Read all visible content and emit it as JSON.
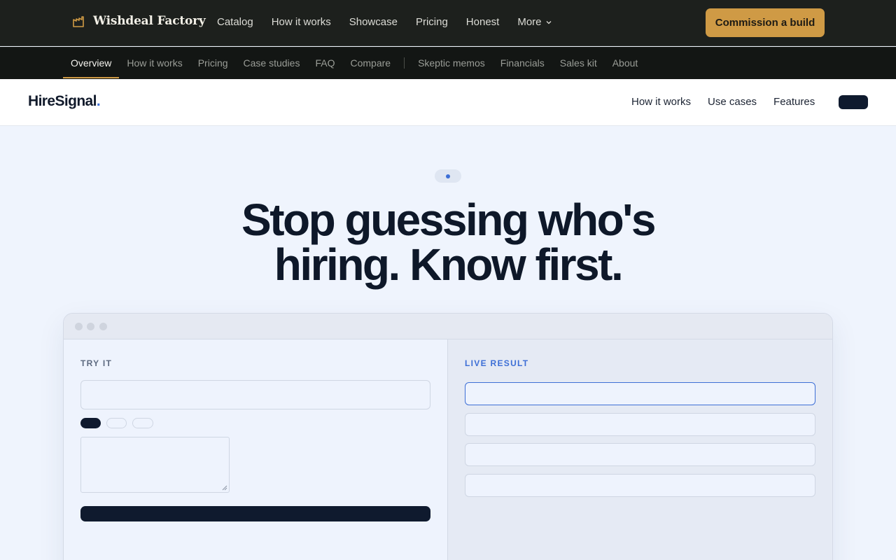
{
  "topbar": {
    "brand": "Wishdeal Factory",
    "nav": [
      "Catalog",
      "How it works",
      "Showcase",
      "Pricing",
      "Honest",
      "More"
    ],
    "cta": "Commission a build"
  },
  "subnav": {
    "primary": [
      "Overview",
      "How it works",
      "Pricing",
      "Case studies",
      "FAQ",
      "Compare"
    ],
    "secondary": [
      "Skeptic memos",
      "Financials",
      "Sales kit",
      "About"
    ],
    "active": "Overview"
  },
  "product": {
    "logo": "HireSignal",
    "logo_dot": ".",
    "nav": [
      "How it works",
      "Use cases",
      "Features"
    ]
  },
  "hero": {
    "line1": "Stop guessing who's",
    "line2": "hiring. Know first."
  },
  "demo": {
    "left_label": "TRY IT",
    "right_label": "LIVE RESULT"
  },
  "colors": {
    "accent_gold": "#cf9a45",
    "accent_blue": "#3d6fd6",
    "navy": "#0f1a2e"
  }
}
